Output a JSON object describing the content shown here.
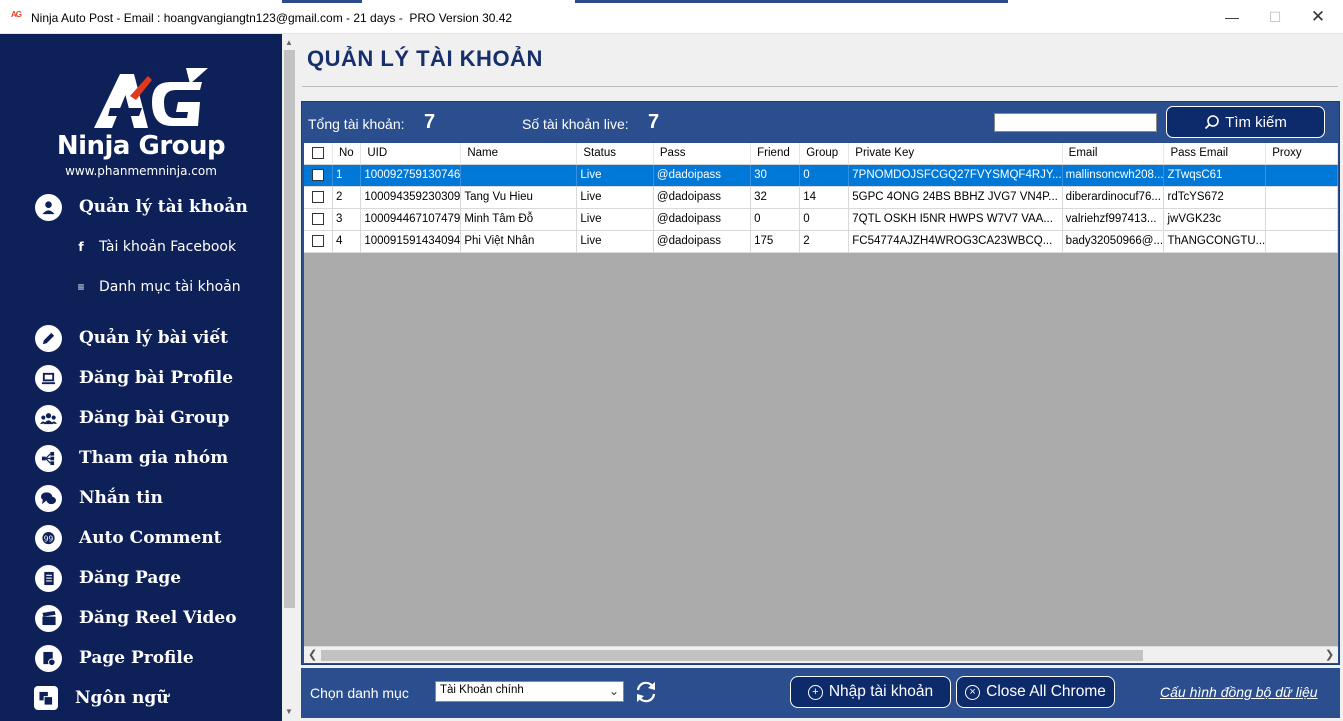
{
  "window": {
    "title": "Ninja Auto Post - Email : hoangvangiangtn123@gmail.com - 21 days -  PRO Version 30.42",
    "app_icon": "AG"
  },
  "sidebar": {
    "brand": "Ninja Group",
    "website": "www.phanmemninja.com",
    "items": [
      {
        "label": "Quản lý tài khoản",
        "icon": "user-icon"
      },
      {
        "label": "Quản lý bài viết",
        "icon": "pen-icon"
      },
      {
        "label": "Đăng bài Profile",
        "icon": "monitor-icon"
      },
      {
        "label": "Đăng bài Group",
        "icon": "group-icon"
      },
      {
        "label": "Tham gia nhóm",
        "icon": "join-group-icon"
      },
      {
        "label": "Nhắn tin",
        "icon": "chat-icon"
      },
      {
        "label": "Auto Comment",
        "icon": "comment-icon"
      },
      {
        "label": "Đăng Page",
        "icon": "page-icon"
      },
      {
        "label": "Đăng Reel Video",
        "icon": "video-icon"
      },
      {
        "label": "Page Profile",
        "icon": "page-profile-icon"
      },
      {
        "label": "Ngôn ngữ",
        "icon": "language-icon"
      }
    ],
    "subitems": [
      {
        "label": "Tài khoản Facebook",
        "icon": "facebook-icon"
      },
      {
        "label": "Danh mục tài khoản",
        "icon": "list-icon"
      }
    ]
  },
  "main": {
    "title": "QUẢN LÝ TÀI KHOẢN",
    "stats": {
      "total_label": "Tổng tài khoản:",
      "total_value": "7",
      "live_label": "Số tài khoản live:",
      "live_value": "7"
    },
    "search": {
      "value": "",
      "button_label": "Tìm kiếm"
    },
    "table": {
      "columns": [
        "No",
        "UID",
        "Name",
        "Status",
        "Pass",
        "Friend",
        "Group",
        "Private Key",
        "Email",
        "Pass Email",
        "Proxy"
      ],
      "rows": [
        {
          "no": "1",
          "uid": "100092759130746",
          "name": "",
          "status": "Live",
          "pass": "@dadoipass",
          "friend": "30",
          "group": "0",
          "key": "7PNOMDOJSFCGQ27FVYSMQF4RJY...",
          "email": "mallinsoncwh208...",
          "pass_email": "ZTwqsC61",
          "proxy": "",
          "selected": true
        },
        {
          "no": "2",
          "uid": "100094359230309",
          "name": "Tang Vu Hieu",
          "status": "Live",
          "pass": "@dadoipass",
          "friend": "32",
          "group": "14",
          "key": "5GPC 4ONG 24BS BBHZ JVG7 VN4P...",
          "email": "diberardinocuf76...",
          "pass_email": "rdTcYS672",
          "proxy": "",
          "selected": false
        },
        {
          "no": "3",
          "uid": "100094467107479",
          "name": "Minh Tâm Đỗ",
          "status": "Live",
          "pass": "@dadoipass",
          "friend": "0",
          "group": "0",
          "key": "7QTL OSKH I5NR HWPS W7V7 VAA...",
          "email": "valriehzf997413...",
          "pass_email": "jwVGK23c",
          "proxy": "",
          "selected": false
        },
        {
          "no": "4",
          "uid": "100091591434094",
          "name": "Phi Việt Nhân",
          "status": "Live",
          "pass": "@dadoipass",
          "friend": "175",
          "group": "2",
          "key": "FC54774AJZH4WROG3CA23WBCQ...",
          "email": "bady32050966@...",
          "pass_email": "ThANGCONGTU...",
          "proxy": "",
          "selected": false
        }
      ]
    },
    "bottom": {
      "category_label": "Chọn danh mục",
      "category_value": "Tài Khoản chính",
      "import_button": "Nhập tài khoản",
      "close_chrome_button": "Close All Chrome",
      "sync_link": "Cấu hình đồng bộ dữ liệu"
    }
  },
  "colors": {
    "sidebar_bg": "#0d2057",
    "panel_blue": "#2b4f8e",
    "title_text": "#17306b",
    "selected_row": "#0078d7"
  }
}
